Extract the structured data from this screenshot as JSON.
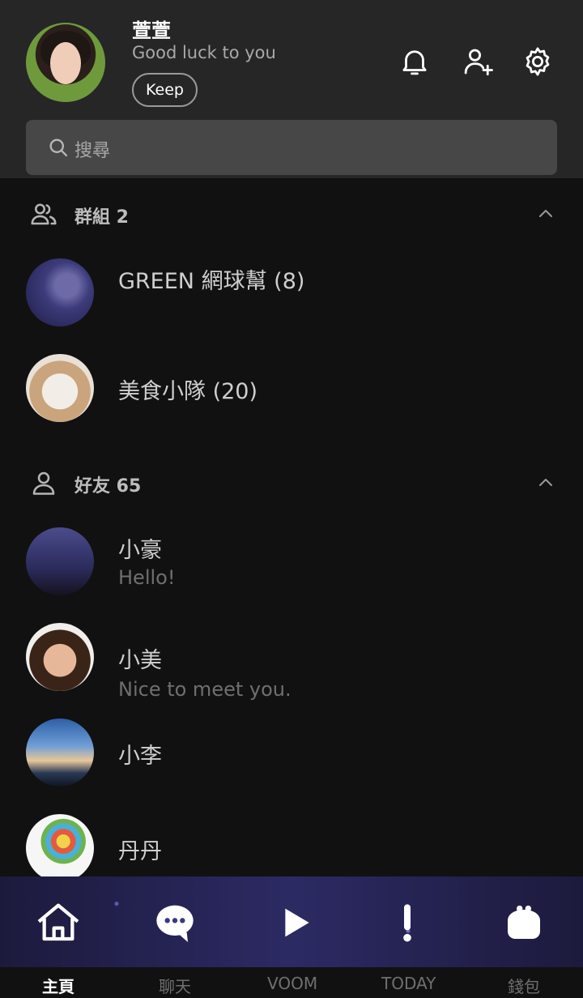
{
  "header": {
    "profile_name": "萱萱",
    "profile_status": "Good luck to you",
    "keep_label": "Keep",
    "icons": [
      "bell-icon",
      "add-friend-icon",
      "gear-icon"
    ]
  },
  "search": {
    "placeholder": "搜尋"
  },
  "groups": {
    "title": "群組 2",
    "items": [
      {
        "name": "GREEN 網球幫 (8)",
        "avatar": "galaxy"
      },
      {
        "name": "美食小隊 (20)",
        "avatar": "cat"
      }
    ]
  },
  "friends": {
    "title": "好友 65",
    "items": [
      {
        "name": "小豪",
        "status": "Hello!",
        "avatar": "night-sky"
      },
      {
        "name": "小美",
        "status": "Nice to meet you.",
        "avatar": "woman"
      },
      {
        "name": "小李",
        "status": "",
        "avatar": "sky"
      },
      {
        "name": "丹丹",
        "status": "",
        "avatar": "balloon"
      }
    ]
  },
  "nav": {
    "tabs": [
      {
        "label": "主頁",
        "icon": "home-icon",
        "active": true
      },
      {
        "label": "聊天",
        "icon": "chat-icon",
        "active": false
      },
      {
        "label": "VOOM",
        "icon": "play-icon",
        "active": false
      },
      {
        "label": "TODAY",
        "icon": "exclamation-icon",
        "active": false
      },
      {
        "label": "錢包",
        "icon": "wallet-icon",
        "active": false
      }
    ]
  },
  "colors": {
    "background": "#111112",
    "header": "#262626",
    "accent": "#ffffff"
  }
}
